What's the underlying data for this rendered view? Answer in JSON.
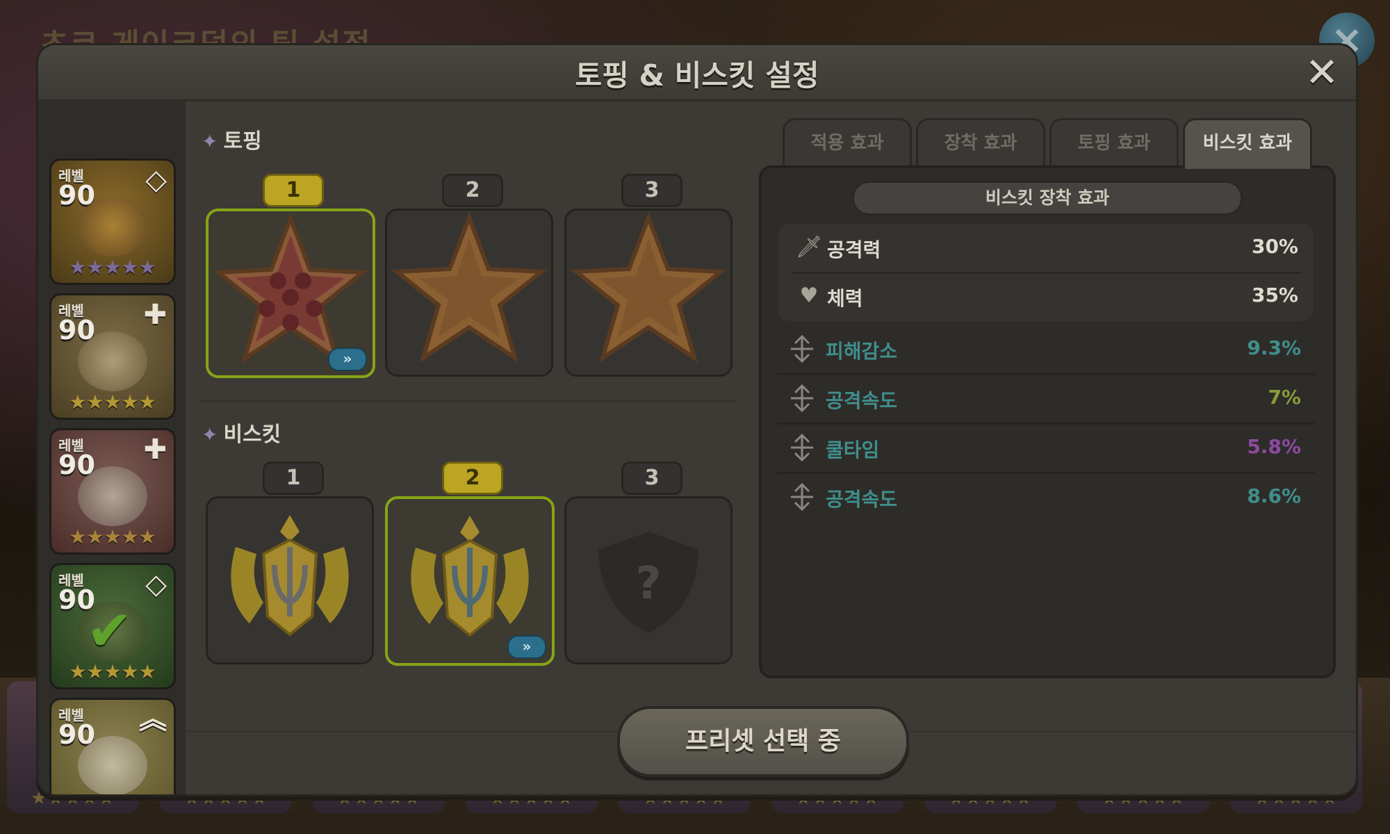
{
  "background": {
    "title": "초코 게이크덤의 팀 설정",
    "close_icon": "×",
    "strip_stars": "★★★★★"
  },
  "dialog": {
    "title": "토핑 & 비스킷 설정",
    "close_icon": "✕"
  },
  "sidebar": {
    "cards": [
      {
        "level_label": "레벨",
        "level": "90",
        "corner": "◇",
        "stars": "★★★★★",
        "bg": "#6b5420"
      },
      {
        "level_label": "레벨",
        "level": "90",
        "corner": "✚",
        "stars": "★★★★★",
        "bg": "#5e5030"
      },
      {
        "level_label": "레벨",
        "level": "90",
        "corner": "✚",
        "stars": "★★★★★",
        "bg": "#5b3b33"
      },
      {
        "level_label": "레벨",
        "level": "90",
        "corner": "◇",
        "stars": "★★★★★",
        "bg": "#2f4a2c",
        "check": "✔"
      },
      {
        "level_label": "레벨",
        "level": "90",
        "corner": "︽",
        "stars": "★★★★★",
        "bg": "#6a6234"
      }
    ]
  },
  "toppings": {
    "heading_icon": "✦",
    "heading": "토핑",
    "slots": [
      {
        "num": "1",
        "active": true,
        "badge": "»",
        "filled": true
      },
      {
        "num": "2",
        "active": false,
        "filled": false
      },
      {
        "num": "3",
        "active": false,
        "filled": false
      }
    ]
  },
  "biscuits": {
    "heading_icon": "✦",
    "heading": "비스킷",
    "slots": [
      {
        "num": "1",
        "active": false
      },
      {
        "num": "2",
        "active": true,
        "badge": "»"
      },
      {
        "num": "3",
        "active": false,
        "locked": "?"
      }
    ]
  },
  "tabs": [
    {
      "label": "적용 효과",
      "active": false
    },
    {
      "label": "장착 효과",
      "active": false
    },
    {
      "label": "토핑 효과",
      "active": false
    },
    {
      "label": "비스킷 효과",
      "active": true
    }
  ],
  "effects": {
    "header": "비스킷 장착 효과",
    "main_stats": [
      {
        "icon": "sword-icon",
        "glyph": "🗡",
        "label": "공격력",
        "value": "30%"
      },
      {
        "icon": "heart-icon",
        "glyph": "♥",
        "label": "체력",
        "value": "35%"
      }
    ],
    "sub_stats": [
      {
        "label": "피해감소",
        "value": "9.3%",
        "color": "#3f8f8c"
      },
      {
        "label": "공격속도",
        "value": "7%",
        "color": "#8a9a3a"
      },
      {
        "label": "쿨타임",
        "value": "5.8%",
        "color": "#8e4aa0"
      },
      {
        "label": "공격속도",
        "value": "8.6%",
        "color": "#3f8f8c"
      }
    ]
  },
  "preset_button": {
    "label": "프리셋 선택 중"
  }
}
